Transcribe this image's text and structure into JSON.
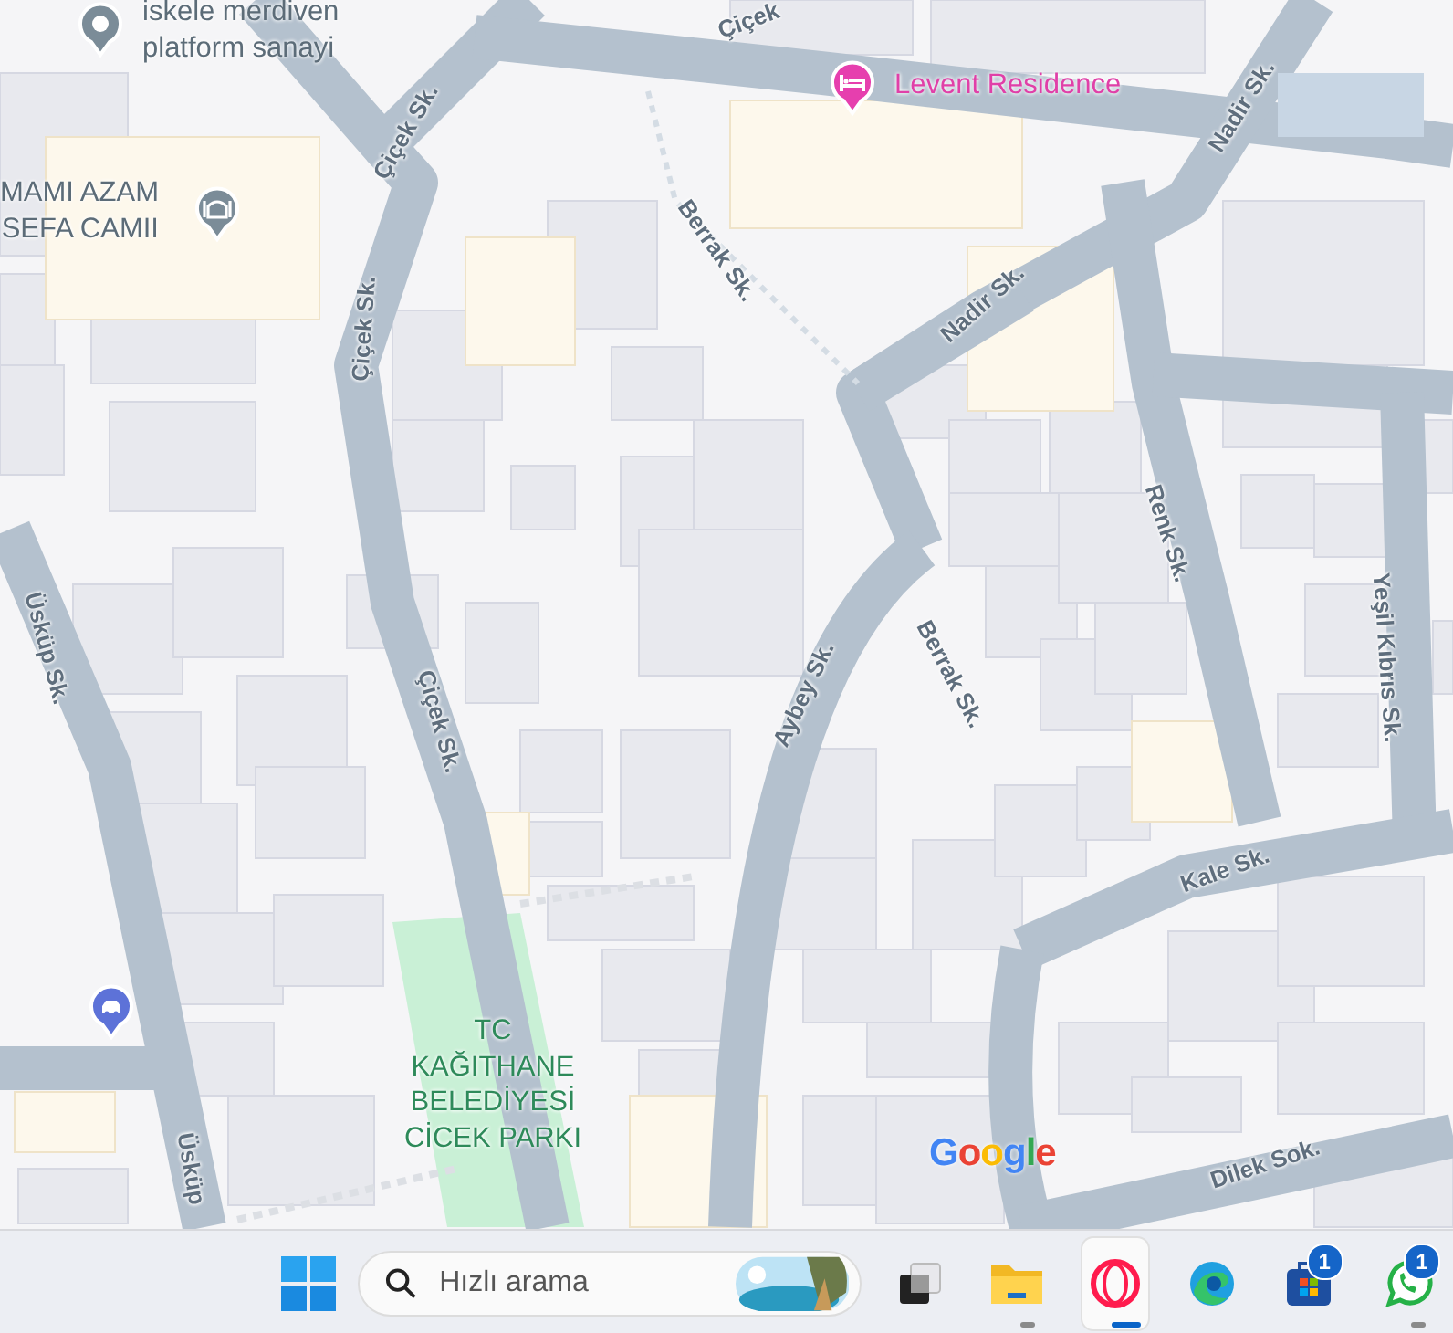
{
  "map": {
    "places": [
      {
        "kind": "pin",
        "lines": [
          "iskele merdiven",
          "platform sanayi"
        ]
      },
      {
        "kind": "mosque",
        "lines": [
          "MAMI AZAM",
          "SEFA CAMII"
        ]
      },
      {
        "kind": "hotel",
        "lines": [
          "Levent Residence"
        ]
      },
      {
        "kind": "park",
        "lines": [
          "TC",
          "KAĞITHANE",
          "BELEDİYESİ",
          "CİCEK PARKI"
        ]
      },
      {
        "kind": "car"
      }
    ],
    "streets": [
      "Çiçek",
      "Çiçek Sk.",
      "Nadir Sk.",
      "Berrak Sk.",
      "Nadir Sk.",
      "Çiçek Sk.",
      "Renk Sk.",
      "Üsküp Sk.",
      "Yeşil Kıbrıs Sk.",
      "Aybey Sk.",
      "Berrak Sk.",
      "Çiçek Sk.",
      "Kale Sk.",
      "Üsküp",
      "Dilek Sok."
    ],
    "logo": "Google"
  },
  "taskbar": {
    "search": {
      "placeholder": "Hızlı arama"
    },
    "apps": [
      {
        "kind": "taskview",
        "selected": false,
        "running": false
      },
      {
        "kind": "explorer",
        "selected": false,
        "running": true
      },
      {
        "kind": "opera",
        "selected": true,
        "running": true
      },
      {
        "kind": "edge",
        "selected": false,
        "running": false
      },
      {
        "kind": "store",
        "selected": false,
        "running": false,
        "badge": "1"
      },
      {
        "kind": "whatsapp",
        "selected": false,
        "running": true,
        "badge": "1"
      }
    ]
  }
}
